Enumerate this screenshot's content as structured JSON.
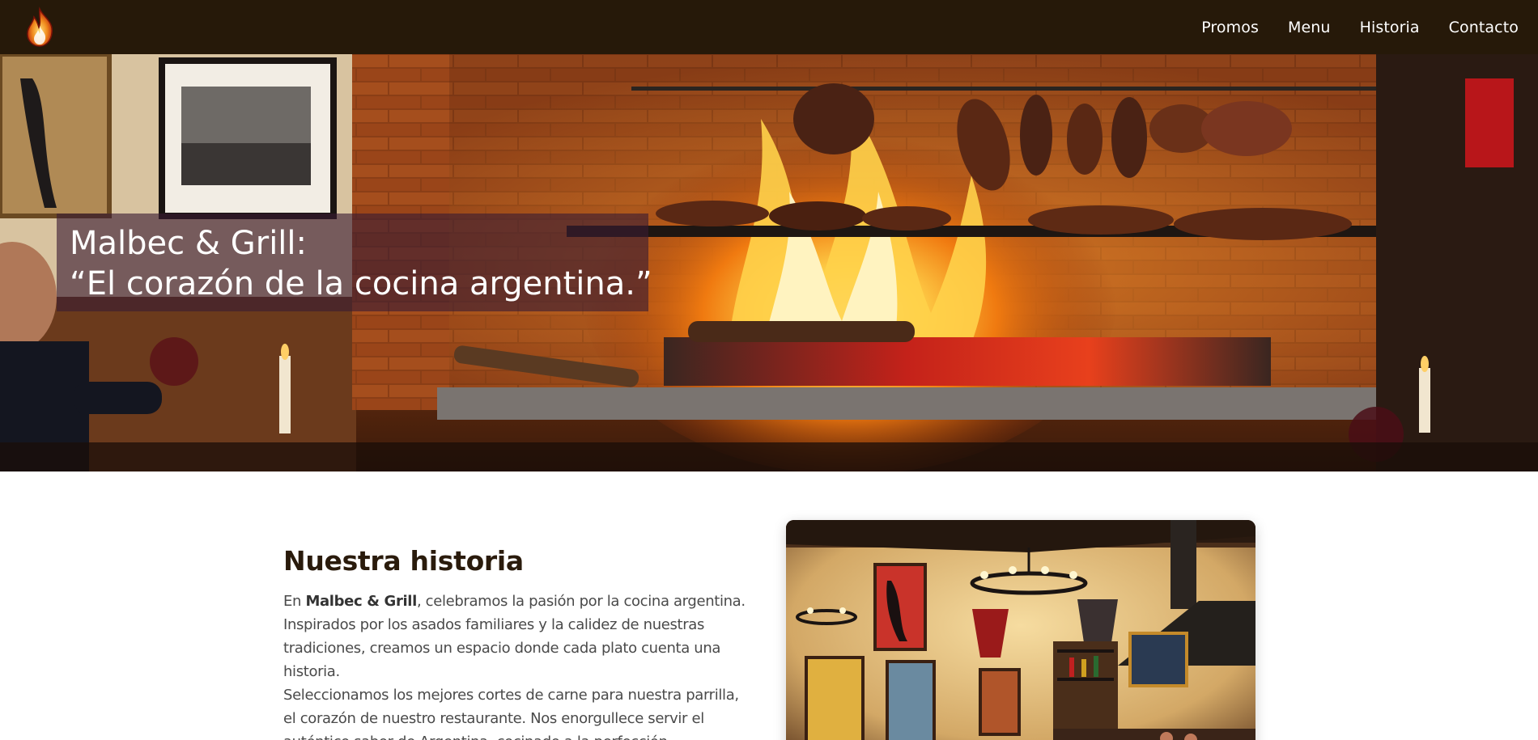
{
  "nav": {
    "logo_icon": "flame-logo-icon",
    "links": [
      "Promos",
      "Menu",
      "Historia",
      "Contacto"
    ]
  },
  "hero": {
    "title_line1": "Malbec & Grill:",
    "title_line2": "“El corazón de la cocina argentina.”"
  },
  "history": {
    "title": "Nuestra historia",
    "p1_prefix": "En ",
    "p1_bold": "Malbec & Grill",
    "p1_rest": ", celebramos la pasión por la cocina argentina. Inspirados por los asados familiares y la calidez de nuestras tradiciones, creamos un espacio donde cada plato cuenta una historia.",
    "p2": "Seleccionamos los mejores cortes de carne para nuestra parrilla, el corazón de nuestro restaurante. Nos enorgullece servir el auténtico sabor de Argentina, cocinado a la perfección."
  },
  "colors": {
    "navbar_bg": "#261909",
    "caption_bg": "rgba(58, 28, 50, 0.62)",
    "heading": "#2a1b0c",
    "body_text": "#4a4a4a"
  }
}
